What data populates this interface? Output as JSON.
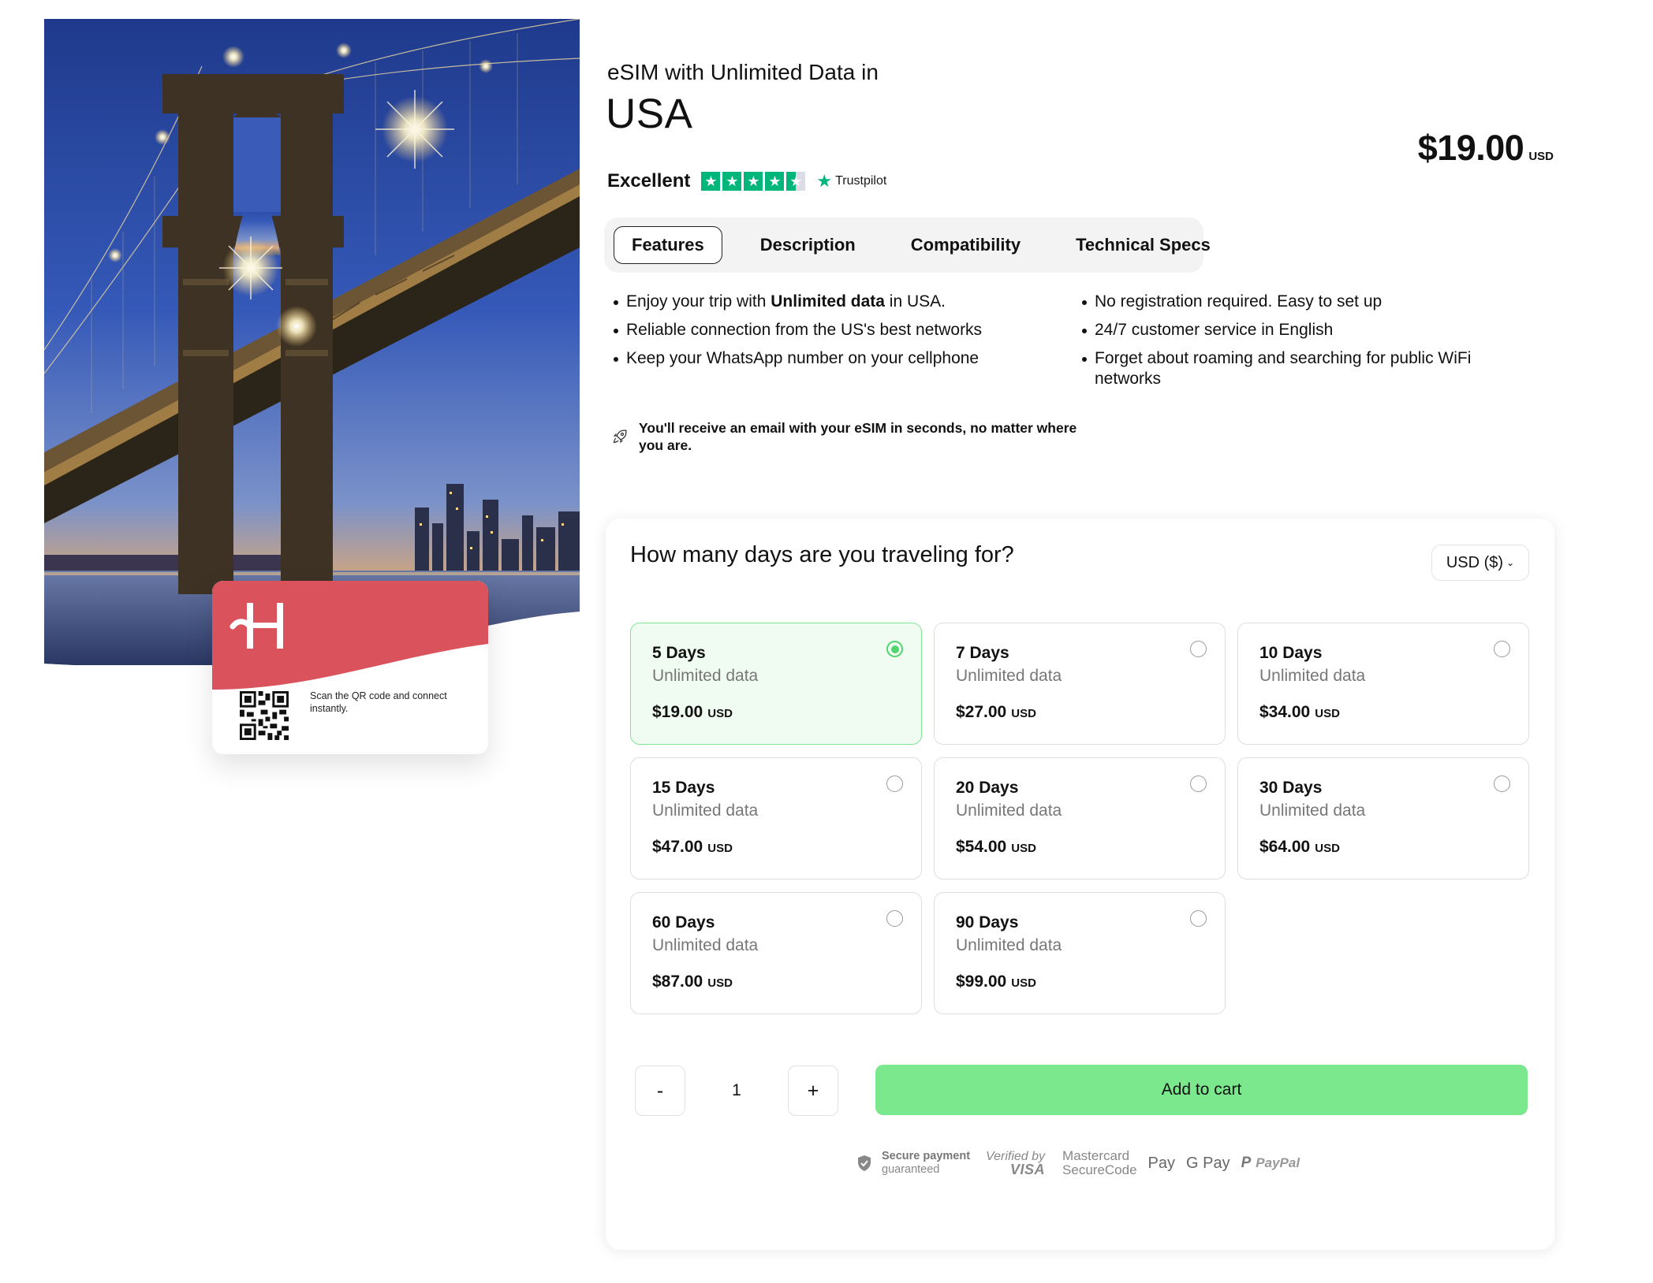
{
  "product": {
    "subtitle": "eSIM with Unlimited Data in",
    "title": "USA",
    "price": "$19.00",
    "currency_unit": "USD"
  },
  "rating": {
    "label": "Excellent",
    "stars": 4.5,
    "brand": "Trustpilot",
    "brand_color": "#00b67a"
  },
  "sim_card": {
    "logo": "H",
    "scan_text": "Scan the QR code and connect instantly.",
    "card_color": "#d9525c"
  },
  "tabs": [
    {
      "label": "Features",
      "active": true
    },
    {
      "label": "Description",
      "active": false
    },
    {
      "label": "Compatibility",
      "active": false
    },
    {
      "label": "Technical Specs",
      "active": false
    }
  ],
  "features": {
    "left": [
      {
        "pre": "Enjoy your trip with ",
        "bold": "Unlimited data",
        "post": " in USA."
      },
      {
        "pre": "Reliable connection from the US's best networks",
        "bold": "",
        "post": ""
      },
      {
        "pre": "Keep your WhatsApp number on your cellphone",
        "bold": "",
        "post": ""
      }
    ],
    "right": [
      "No registration required. Easy to set up",
      "24/7 customer service in English",
      "Forget about roaming and searching for public WiFi networks"
    ],
    "notice": "You'll receive an email with your eSIM in seconds, no matter where you are.",
    "notice_icon": "rocket-icon"
  },
  "selector": {
    "question": "How many days are you traveling for?",
    "currency": "USD ($)",
    "plans": [
      {
        "days": "5 Days",
        "data": "Unlimited data",
        "price": "$19.00",
        "unit": "USD",
        "selected": true
      },
      {
        "days": "7 Days",
        "data": "Unlimited data",
        "price": "$27.00",
        "unit": "USD",
        "selected": false
      },
      {
        "days": "10 Days",
        "data": "Unlimited data",
        "price": "$34.00",
        "unit": "USD",
        "selected": false
      },
      {
        "days": "15 Days",
        "data": "Unlimited data",
        "price": "$47.00",
        "unit": "USD",
        "selected": false
      },
      {
        "days": "20 Days",
        "data": "Unlimited data",
        "price": "$54.00",
        "unit": "USD",
        "selected": false
      },
      {
        "days": "30 Days",
        "data": "Unlimited data",
        "price": "$64.00",
        "unit": "USD",
        "selected": false
      },
      {
        "days": "60 Days",
        "data": "Unlimited data",
        "price": "$87.00",
        "unit": "USD",
        "selected": false
      },
      {
        "days": "90 Days",
        "data": "Unlimited data",
        "price": "$99.00",
        "unit": "USD",
        "selected": false
      }
    ],
    "selected_color": "#52d46e"
  },
  "cart": {
    "minus": "-",
    "quantity": "1",
    "plus": "+",
    "add_label": "Add to cart",
    "button_color": "#7ce88d"
  },
  "payments": {
    "secure_line1": "Secure payment",
    "secure_line2": "guaranteed",
    "visa_line1": "Verified by",
    "visa_line2": "VISA",
    "mc_line1": "Mastercard",
    "mc_line2": "SecureCode",
    "apple_pay": "Pay",
    "google_pay": "G Pay",
    "paypal": "PayPal"
  }
}
